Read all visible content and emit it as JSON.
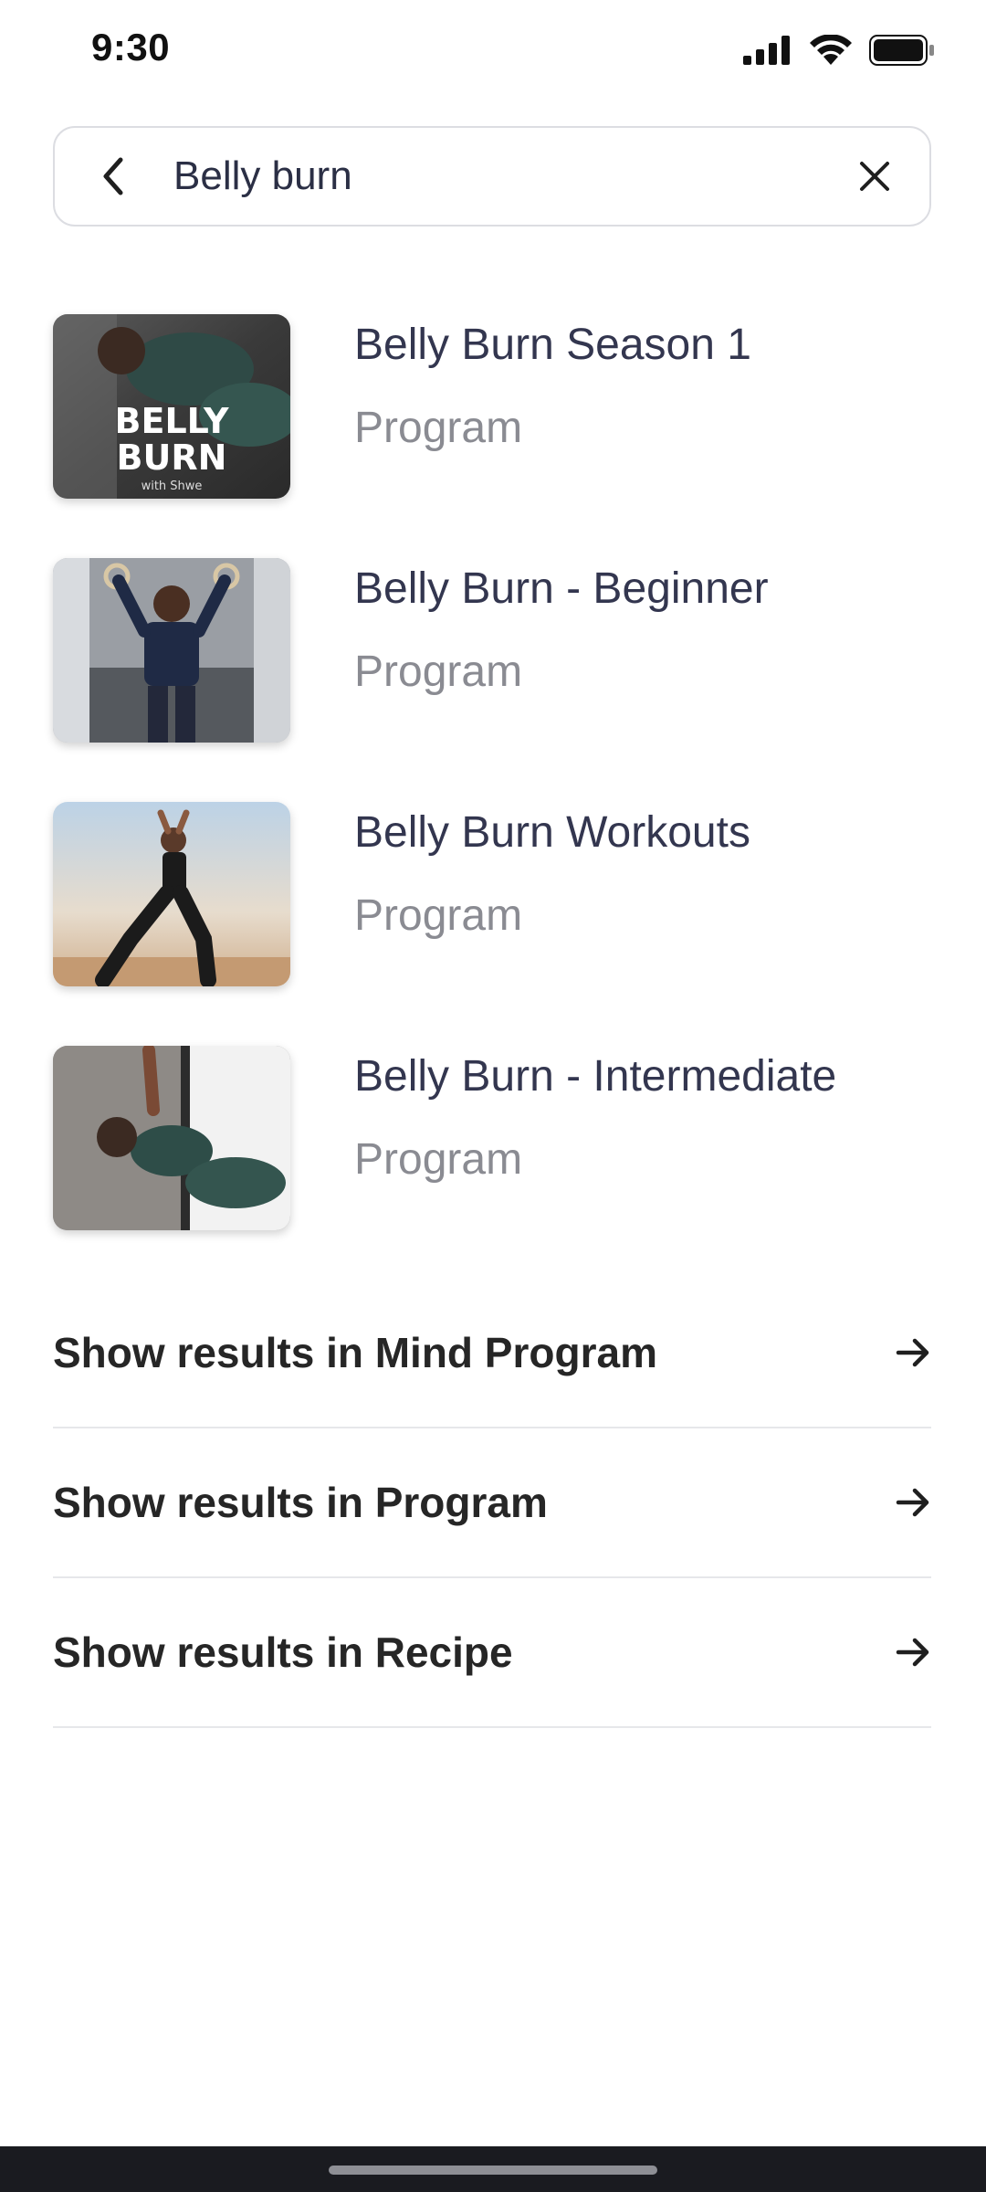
{
  "status_bar": {
    "time": "9:30",
    "icons": [
      "signal-icon",
      "wifi-icon",
      "battery-icon"
    ]
  },
  "search": {
    "value": "Belly burn",
    "back_icon": "chevron-left-icon",
    "clear_icon": "close-icon"
  },
  "results": [
    {
      "title": "Belly Burn Season 1",
      "subtitle": "Program",
      "thumb_text_1": "BELLY",
      "thumb_text_2": "BURN",
      "thumb_text_3": "with Shwe"
    },
    {
      "title": "Belly Burn - Beginner",
      "subtitle": "Program"
    },
    {
      "title": "Belly Burn Workouts",
      "subtitle": "Program"
    },
    {
      "title": "Belly Burn - Intermediate",
      "subtitle": "Program"
    }
  ],
  "category_links": [
    {
      "label": "Show results in Mind Program",
      "icon": "arrow-right-icon"
    },
    {
      "label": "Show results in Program",
      "icon": "arrow-right-icon"
    },
    {
      "label": "Show results in Recipe",
      "icon": "arrow-right-icon"
    }
  ],
  "colors": {
    "title_text": "#33364f",
    "subtitle_text": "#8a8b92",
    "link_text": "#262626",
    "divider": "#e6e7ea",
    "search_border": "#dcdde2"
  }
}
